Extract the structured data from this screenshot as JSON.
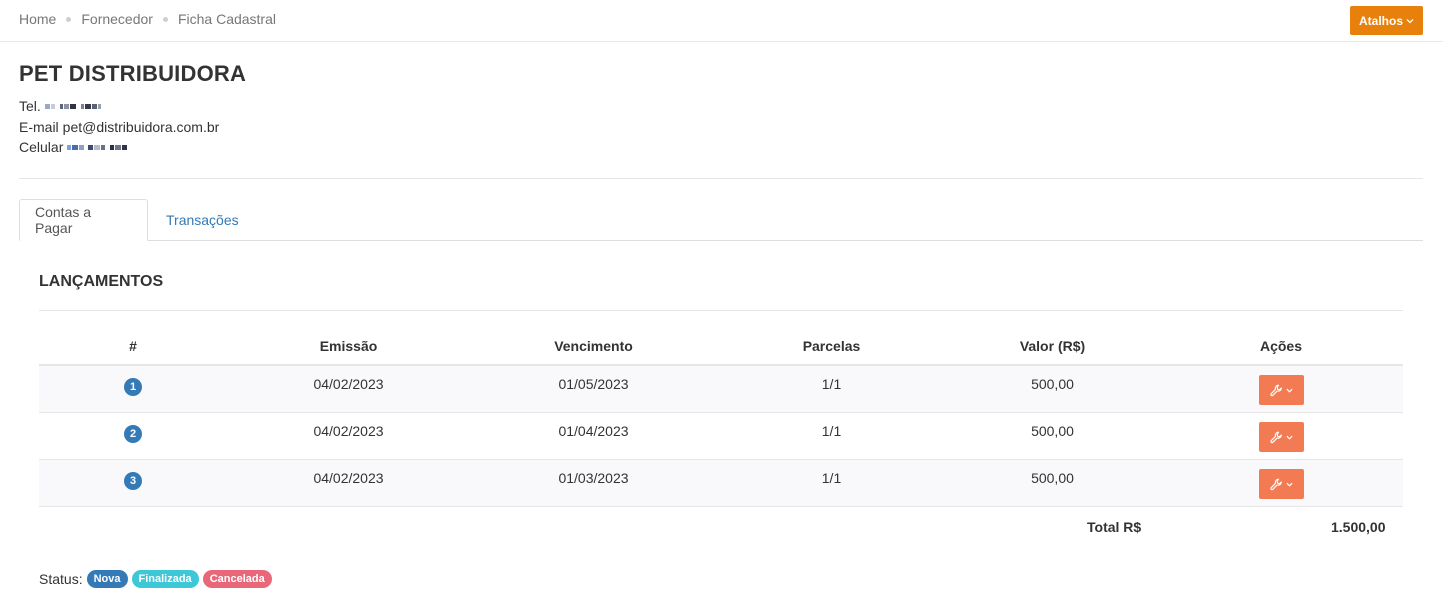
{
  "breadcrumb": [
    "Home",
    "Fornecedor",
    "Ficha Cadastral"
  ],
  "shortcuts_button": "Atalhos",
  "supplier": {
    "name": "PET DISTRIBUIDORA",
    "tel_label": "Tel.",
    "email_label": "E-mail",
    "email": "pet@distribuidora.com.br",
    "celular_label": "Celular"
  },
  "tabs": [
    {
      "label": "Contas a Pagar",
      "active": true
    },
    {
      "label": "Transações",
      "active": false
    }
  ],
  "section_title": "LANÇAMENTOS",
  "table": {
    "headers": [
      "#",
      "Emissão",
      "Vencimento",
      "Parcelas",
      "Valor (R$)",
      "Ações"
    ],
    "rows": [
      {
        "num": "1",
        "emissao": "04/02/2023",
        "vencimento": "01/05/2023",
        "parcelas": "1/1",
        "valor": "500,00"
      },
      {
        "num": "2",
        "emissao": "04/02/2023",
        "vencimento": "01/04/2023",
        "parcelas": "1/1",
        "valor": "500,00"
      },
      {
        "num": "3",
        "emissao": "04/02/2023",
        "vencimento": "01/03/2023",
        "parcelas": "1/1",
        "valor": "500,00"
      }
    ],
    "total_label": "Total R$",
    "total_value": "1.500,00"
  },
  "status_legend": {
    "label": "Status:",
    "badges": [
      "Nova",
      "Finalizada",
      "Cancelada"
    ]
  },
  "colors": {
    "accent_orange": "#e8800c",
    "action_button": "#f37b53",
    "status_nova": "#337ab7",
    "status_finalizada": "#3ec7d6",
    "status_cancelada": "#e8687a",
    "link": "#337ab7"
  },
  "icons": {
    "row_action": "wrench-icon",
    "dropdown": "chevron-down-icon"
  }
}
